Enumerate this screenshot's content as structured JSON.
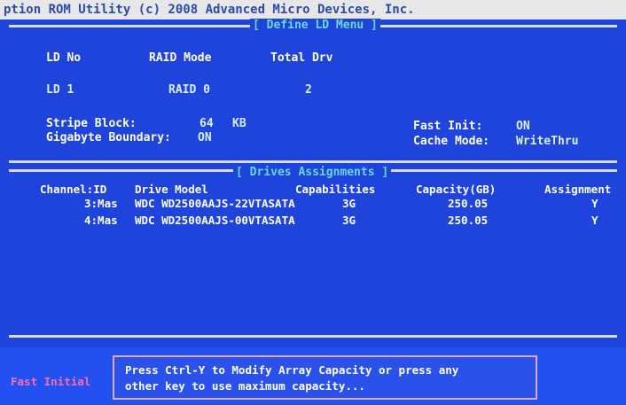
{
  "title_bar": {
    "text": "ption ROM Utility (c) 2008 Advanced Micro Devices, Inc."
  },
  "define_menu": {
    "title": "[ Define LD Menu ]",
    "headers": {
      "ld_no": "LD No",
      "raid_mode": "RAID Mode",
      "total_drv": "Total Drv"
    },
    "values": {
      "ld_no": "LD  1",
      "raid_mode": "RAID 0",
      "total_drv": "2"
    },
    "stripe_block_label": "Stripe Block:",
    "stripe_block_value": "64",
    "stripe_block_unit": "KB",
    "gigabyte_boundary_label": "Gigabyte Boundary:",
    "gigabyte_boundary_value": "ON",
    "fast_init_label": "Fast Init:",
    "fast_init_value": "ON",
    "cache_mode_label": "Cache Mode:",
    "cache_mode_value": "WriteThru"
  },
  "drives": {
    "title": "[ Drives Assignments ]",
    "columns": {
      "channel_id": "Channel:ID",
      "drive_model": "Drive Model",
      "capabilities": "Capabilities",
      "capacity": "Capacity(GB)",
      "assignment": "Assignment"
    },
    "rows": [
      {
        "channel": "3:Mas",
        "model": "WDC WD2500AAJS-22VTASATA",
        "cap": "3G",
        "capacity": "250.05",
        "assign": "Y"
      },
      {
        "channel": "4:Mas",
        "model": "WDC WD2500AAJS-00VTASATA",
        "cap": "3G",
        "capacity": "250.05",
        "assign": "Y"
      }
    ]
  },
  "bottom": {
    "fast_init_text": "Fast Initial",
    "message_line1": "Press Ctrl-Y to Modify Array Capacity or press any",
    "message_line2": "other key to use maximum capacity..."
  }
}
